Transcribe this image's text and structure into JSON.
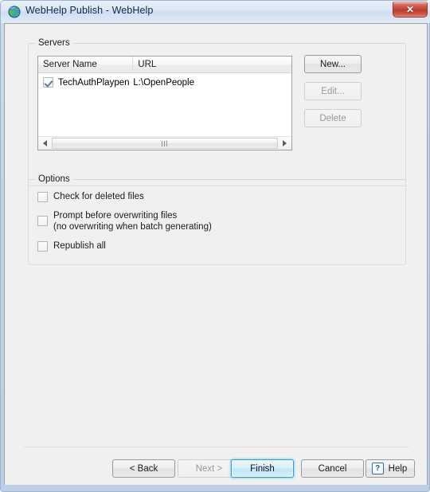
{
  "window": {
    "title": "WebHelp Publish - WebHelp",
    "icon": "globe-icon",
    "close_label": "✕",
    "accent_color": "#2c9fd4",
    "titlebar_color": "#cedef0",
    "body_color": "#f0f0f0"
  },
  "servers_group": {
    "legend": "Servers",
    "columns": [
      "Server Name",
      "URL"
    ],
    "rows": [
      {
        "checked": true,
        "server_name": "TechAuthPlaypen",
        "url": "L:\\OpenPeople"
      }
    ],
    "buttons": {
      "new": "New...",
      "edit": "Edit...",
      "delete": "Delete"
    },
    "scrollbar": {
      "left_arrow": "◀",
      "right_arrow": "▶"
    }
  },
  "options_group": {
    "legend": "Options",
    "items": [
      {
        "label": "Check for deleted files",
        "checked": false
      },
      {
        "label": "Prompt before overwriting files\n(no overwriting when batch generating)",
        "checked": false
      },
      {
        "label": "Republish all",
        "checked": false
      }
    ]
  },
  "footer": {
    "back": "< Back",
    "next": "Next >",
    "finish": "Finish",
    "cancel": "Cancel",
    "help": "Help",
    "help_icon_glyph": "?"
  }
}
